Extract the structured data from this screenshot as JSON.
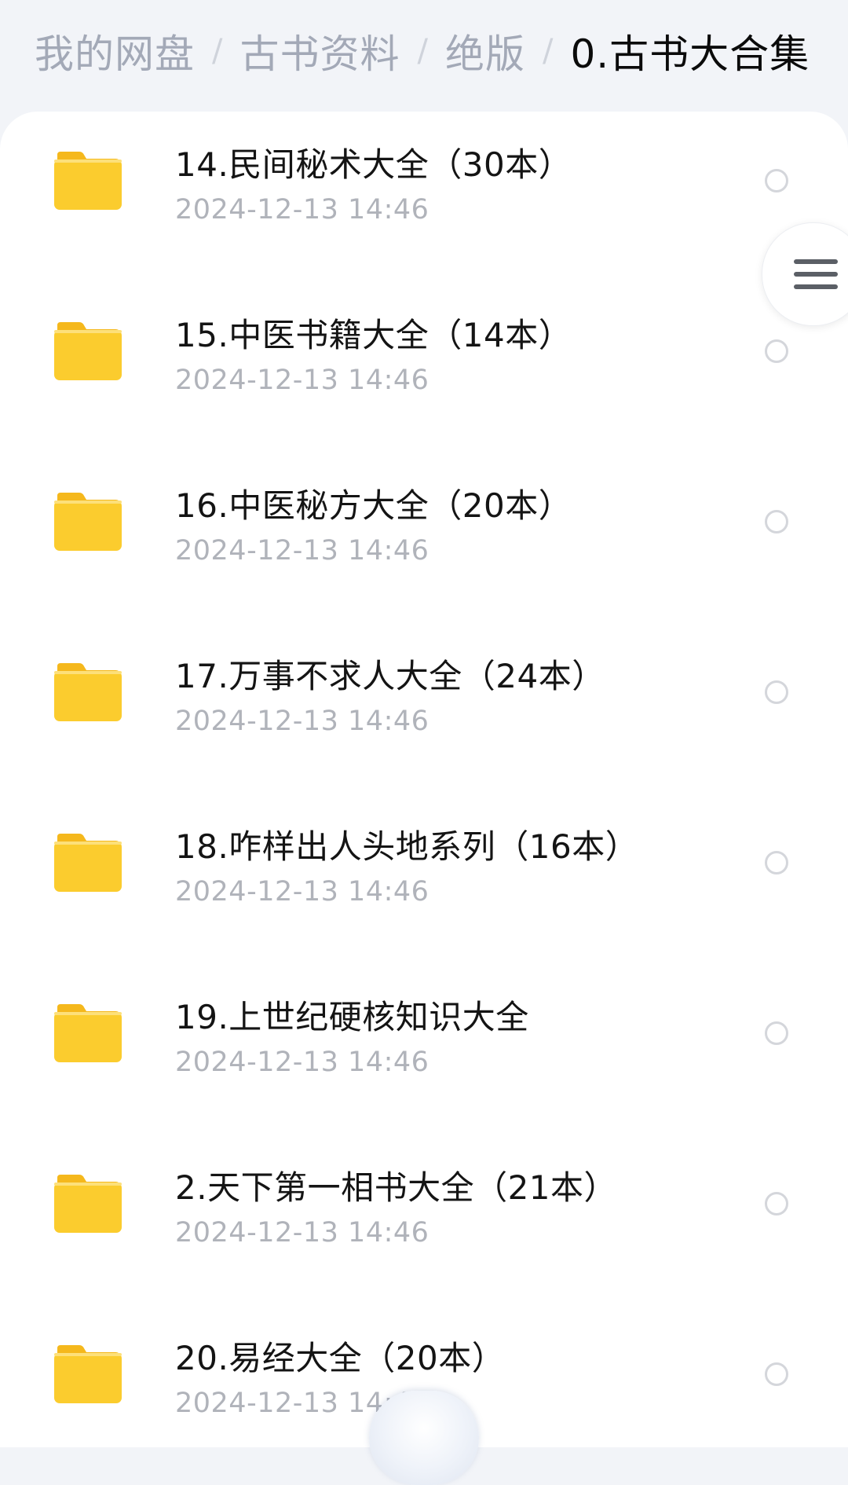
{
  "breadcrumb": {
    "items": [
      "我的网盘",
      "古书资料",
      "绝版",
      "0.古书大合集"
    ],
    "separator": "/"
  },
  "colors": {
    "folder": "#fbcc2e",
    "folder_tab": "#f5b81c",
    "title": "#141414",
    "date": "#b0b3ba",
    "breadcrumb_inactive": "#a3a9b7",
    "breadcrumb_active": "#0b0b0b"
  },
  "files": [
    {
      "name": "14.民间秘术大全（30本）",
      "date": "2024-12-13  14:46",
      "icon": "folder-icon"
    },
    {
      "name": "15.中医书籍大全（14本）",
      "date": "2024-12-13  14:46",
      "icon": "folder-icon"
    },
    {
      "name": "16.中医秘方大全（20本）",
      "date": "2024-12-13  14:46",
      "icon": "folder-icon"
    },
    {
      "name": "17.万事不求人大全（24本）",
      "date": "2024-12-13  14:46",
      "icon": "folder-icon"
    },
    {
      "name": "18.咋样出人头地系列（16本）",
      "date": "2024-12-13  14:46",
      "icon": "folder-icon"
    },
    {
      "name": "19.上世纪硬核知识大全",
      "date": "2024-12-13  14:46",
      "icon": "folder-icon"
    },
    {
      "name": "2.天下第一相书大全（21本）",
      "date": "2024-12-13  14:46",
      "icon": "folder-icon"
    },
    {
      "name": "20.易经大全（20本）",
      "date": "2024-12-13  14:4",
      "icon": "folder-icon"
    }
  ],
  "floating_menu": {
    "icon": "menu-icon"
  }
}
